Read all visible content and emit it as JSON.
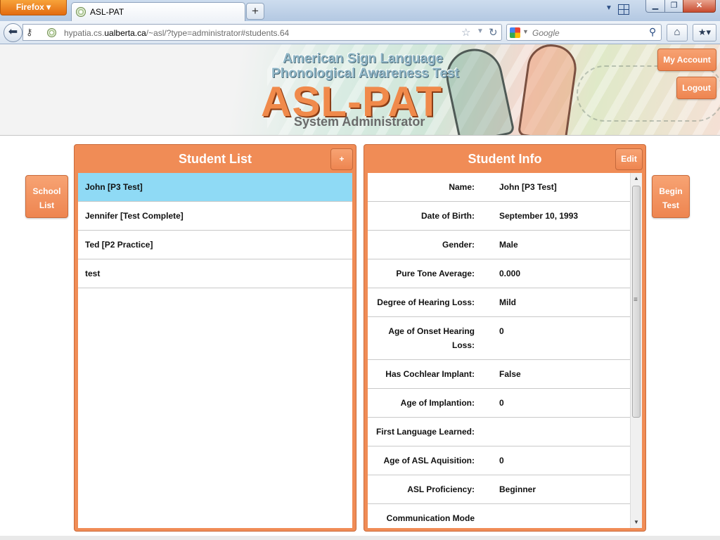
{
  "browser": {
    "app_button": "Firefox ▾",
    "tab_title": "ASL-PAT",
    "new_tab": "+",
    "url_prefix": "hypatia.cs.",
    "url_domain": "ualberta.ca",
    "url_path": "/~asl/?type=administrator#students.64",
    "search_placeholder": "Google"
  },
  "banner": {
    "subtitle1": "American Sign Language",
    "subtitle2": "Phonological Awareness Test",
    "title": "ASL-PAT",
    "role": "System Administrator"
  },
  "header_buttons": {
    "my_account": "My Account",
    "logout": "Logout"
  },
  "side_buttons": {
    "school_list_line1": "School",
    "school_list_line2": "List",
    "begin_test_line1": "Begin",
    "begin_test_line2": "Test"
  },
  "student_list": {
    "title": "Student List",
    "add_label": "+",
    "students": [
      {
        "name": "John [P3 Test]",
        "selected": true
      },
      {
        "name": "Jennifer [Test Complete]",
        "selected": false
      },
      {
        "name": "Ted [P2 Practice]",
        "selected": false
      },
      {
        "name": "test",
        "selected": false
      }
    ]
  },
  "student_info": {
    "title": "Student Info",
    "edit_label": "Edit",
    "fields": [
      {
        "label": "Name:",
        "value": "John [P3 Test]"
      },
      {
        "label": "Date of Birth:",
        "value": "September 10, 1993"
      },
      {
        "label": "Gender:",
        "value": "Male"
      },
      {
        "label": "Pure Tone Average:",
        "value": "0.000"
      },
      {
        "label": "Degree of Hearing Loss:",
        "value": "Mild"
      },
      {
        "label": "Age of Onset Hearing Loss:",
        "value": "0"
      },
      {
        "label": "Has Cochlear Implant:",
        "value": "False"
      },
      {
        "label": "Age of Implantion:",
        "value": "0"
      },
      {
        "label": "First Language Learned:",
        "value": ""
      },
      {
        "label": "Age of ASL Aquisition:",
        "value": "0"
      },
      {
        "label": "ASL Proficiency:",
        "value": "Beginner"
      },
      {
        "label": "Communication Mode",
        "value": ""
      }
    ]
  },
  "colors": {
    "accent": "#f08c56",
    "selected_row": "#8fdaf5"
  }
}
